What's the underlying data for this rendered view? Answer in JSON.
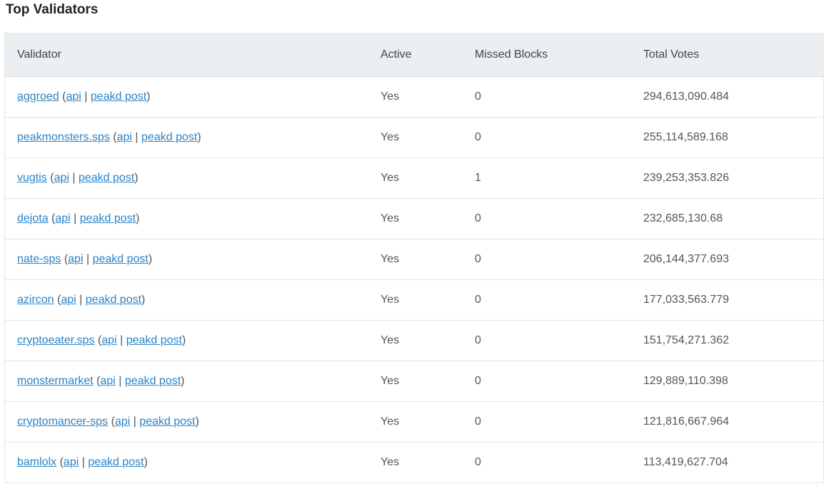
{
  "page": {
    "title": "Top Validators"
  },
  "table": {
    "columns": [
      "Validator",
      "Active",
      "Missed Blocks",
      "Total Votes"
    ],
    "link_labels": {
      "api": "api",
      "post": "peakd post"
    },
    "rows": [
      {
        "validator": "aggroed",
        "active": "Yes",
        "missed_blocks": "0",
        "total_votes": "294,613,090.484"
      },
      {
        "validator": "peakmonsters.sps",
        "active": "Yes",
        "missed_blocks": "0",
        "total_votes": "255,114,589.168"
      },
      {
        "validator": "vugtis",
        "active": "Yes",
        "missed_blocks": "1",
        "total_votes": "239,253,353.826"
      },
      {
        "validator": "dejota",
        "active": "Yes",
        "missed_blocks": "0",
        "total_votes": "232,685,130.68"
      },
      {
        "validator": "nate-sps",
        "active": "Yes",
        "missed_blocks": "0",
        "total_votes": "206,144,377.693"
      },
      {
        "validator": "azircon",
        "active": "Yes",
        "missed_blocks": "0",
        "total_votes": "177,033,563.779"
      },
      {
        "validator": "cryptoeater.sps",
        "active": "Yes",
        "missed_blocks": "0",
        "total_votes": "151,754,271.362"
      },
      {
        "validator": "monstermarket",
        "active": "Yes",
        "missed_blocks": "0",
        "total_votes": "129,889,110.398"
      },
      {
        "validator": "cryptomancer-sps",
        "active": "Yes",
        "missed_blocks": "0",
        "total_votes": "121,816,667.964"
      },
      {
        "validator": "bamlolx",
        "active": "Yes",
        "missed_blocks": "0",
        "total_votes": "113,419,627.704"
      }
    ]
  },
  "colors": {
    "link": "#2a83c6",
    "header_bg": "#eceff1",
    "text": "#555555"
  }
}
